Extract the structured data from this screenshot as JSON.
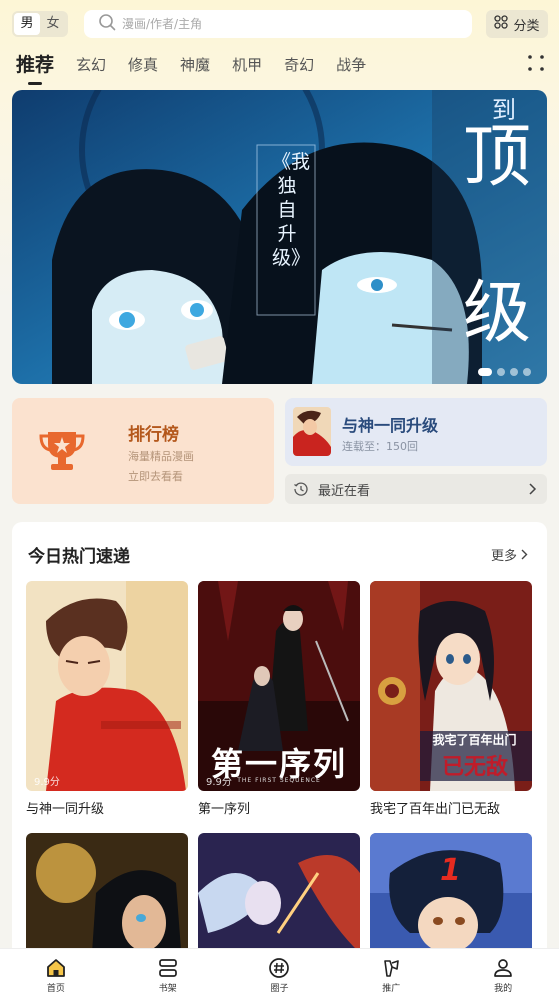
{
  "top_bar": {
    "gender": {
      "male": "男",
      "female": "女",
      "selected": "male"
    },
    "search_placeholder": "漫画/作者/主角",
    "category_label": "分类"
  },
  "tabs": [
    {
      "label": "推荐",
      "active": true
    },
    {
      "label": "玄幻"
    },
    {
      "label": "修真"
    },
    {
      "label": "神魔"
    },
    {
      "label": "机甲"
    },
    {
      "label": "奇幻"
    },
    {
      "label": "战争"
    }
  ],
  "banner": {
    "subtitle": "《我独自升级》",
    "title_chars": [
      "顶",
      "级"
    ],
    "title_small": "到",
    "slide_count": 4,
    "active_slide": 0
  },
  "ranking": {
    "title": "排行榜",
    "subtitle": "海量精品漫画",
    "action": "立即去看看",
    "color": "#b4581c"
  },
  "history": {
    "title": "与神一同升级",
    "progress": "连载至：150回",
    "recent_label": "最近在看"
  },
  "hot": {
    "title": "今日热门速递",
    "more_label": "更多",
    "items": [
      {
        "name": "与神一同升级",
        "score": "9.9分"
      },
      {
        "name": "第一序列",
        "score": "9.9分",
        "logo": "第一序列",
        "logo_en": "THE FIRST SEQUENCE"
      },
      {
        "name": "我宅了百年出门已无敌",
        "logo_top": "我宅了百年出门",
        "logo_main": "已无敌"
      },
      {
        "name": "",
        "score": ""
      },
      {
        "name": "",
        "score": ""
      },
      {
        "name": "",
        "score": "",
        "badge": "1"
      }
    ]
  },
  "bottom_nav": [
    {
      "label": "首页",
      "icon": "home-icon",
      "active": true
    },
    {
      "label": "书架",
      "icon": "bookshelf-icon"
    },
    {
      "label": "圈子",
      "icon": "community-icon"
    },
    {
      "label": "推广",
      "icon": "promote-icon"
    },
    {
      "label": "我的",
      "icon": "profile-icon"
    }
  ]
}
